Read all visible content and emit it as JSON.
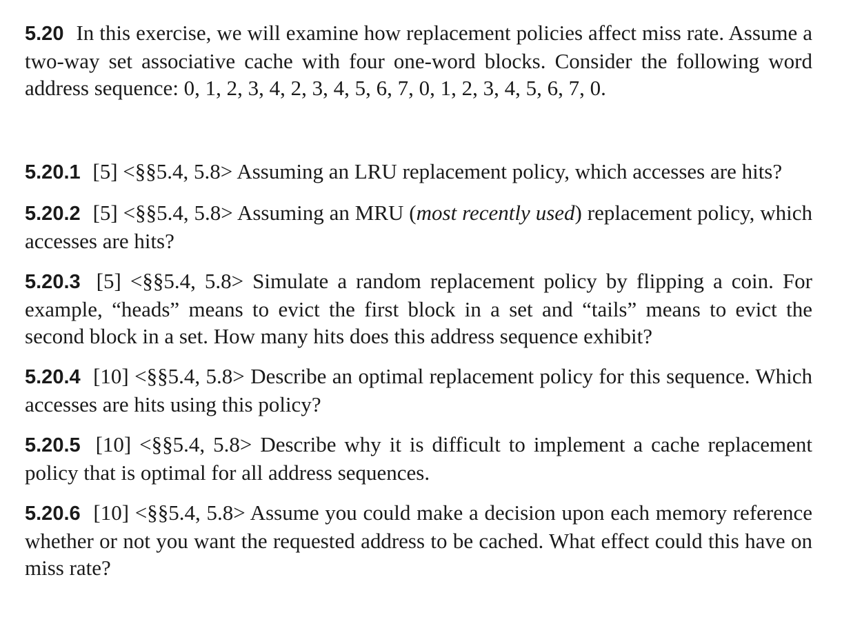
{
  "intro": {
    "number": "5.20",
    "text": "In this exercise, we will examine how replacement policies affect miss rate. Assume a two-way set associative cache with four one-word blocks. Consider the following word address sequence: 0, 1, 2, 3, 4, 2, 3, 4, 5, 6, 7, 0, 1, 2, 3, 4, 5, 6, 7, 0."
  },
  "exercises": [
    {
      "number": "5.20.1",
      "meta": "[5] <§§5.4, 5.8>",
      "text": "Assuming an LRU replacement policy, which accesses are hits?"
    },
    {
      "number": "5.20.2",
      "meta": "[5] <§§5.4, 5.8>",
      "text_before": "Assuming an MRU (",
      "italic": "most recently used",
      "text_after": ") replacement policy, which accesses are hits?"
    },
    {
      "number": "5.20.3",
      "meta": "[5] <§§5.4, 5.8>",
      "text": "Simulate a random replacement policy by flipping a coin. For example, “heads” means to evict the first block in a set and “tails” means to evict the second block in a set. How many hits does this address sequence exhibit?"
    },
    {
      "number": "5.20.4",
      "meta": "[10] <§§5.4, 5.8>",
      "text": "Describe an optimal replacement policy for this sequence. Which accesses are hits using this policy?"
    },
    {
      "number": "5.20.5",
      "meta": "[10] <§§5.4, 5.8>",
      "text": "Describe why it is difficult to implement a cache replacement policy that is optimal for all address sequences."
    },
    {
      "number": "5.20.6",
      "meta": "[10] <§§5.4, 5.8>",
      "text": "Assume you could make a decision upon each memory reference whether or not you want the requested address to be cached. What effect could this have on miss rate?"
    }
  ]
}
